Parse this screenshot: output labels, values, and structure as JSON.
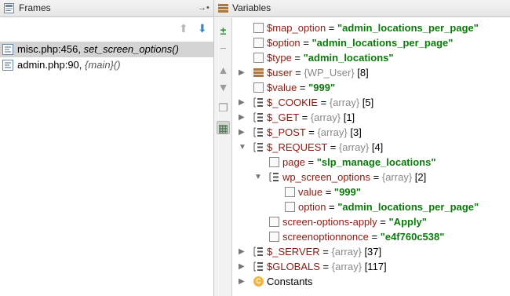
{
  "frames_panel": {
    "title": "Frames",
    "frames": [
      {
        "location": "misc.php:456,",
        "function": "set_screen_options()",
        "selected": true
      },
      {
        "location": "admin.php:90,",
        "function": "{main}()",
        "selected": false
      }
    ]
  },
  "variables_panel": {
    "title": "Variables",
    "rows": [
      {
        "name": "$map_option",
        "eq": " = ",
        "value": "\"admin_locations_per_page\""
      },
      {
        "name": "$option",
        "eq": " = ",
        "value": "\"admin_locations_per_page\""
      },
      {
        "name": "$type",
        "eq": " = ",
        "value": "\"admin_locations\""
      },
      {
        "name": "$user",
        "eq": " = ",
        "type": "{WP_User}",
        "count": " [8]"
      },
      {
        "name": "$value",
        "eq": " = ",
        "value": "\"999\""
      },
      {
        "name": "$_COOKIE",
        "eq": " = ",
        "type": "{array}",
        "count": " [5]"
      },
      {
        "name": "$_GET",
        "eq": " = ",
        "type": "{array}",
        "count": " [1]"
      },
      {
        "name": "$_POST",
        "eq": " = ",
        "type": "{array}",
        "count": " [3]"
      },
      {
        "name": "$_REQUEST",
        "eq": " = ",
        "type": "{array}",
        "count": " [4]"
      },
      {
        "name": "page",
        "eq": " = ",
        "value": "\"slp_manage_locations\""
      },
      {
        "name": "wp_screen_options",
        "eq": " = ",
        "type": "{array}",
        "count": " [2]"
      },
      {
        "name": "value",
        "eq": " = ",
        "value": "\"999\""
      },
      {
        "name": "option",
        "eq": " = ",
        "value": "\"admin_locations_per_page\""
      },
      {
        "name": "screen-options-apply",
        "eq": " = ",
        "value": "\"Apply\""
      },
      {
        "name": "screenoptionnonce",
        "eq": " = ",
        "value": "\"e4f760c538\""
      },
      {
        "name": "$_SERVER",
        "eq": " = ",
        "type": "{array}",
        "count": " [37]"
      },
      {
        "name": "$GLOBALS",
        "eq": " = ",
        "type": "{array}",
        "count": " [117]"
      },
      {
        "name": "Constants"
      }
    ]
  },
  "colors": {
    "variable_name": "#8b1a10",
    "string_value": "#0b7a0b",
    "type_text": "#8a8a8a",
    "selected_row": "#d4d4d4"
  }
}
